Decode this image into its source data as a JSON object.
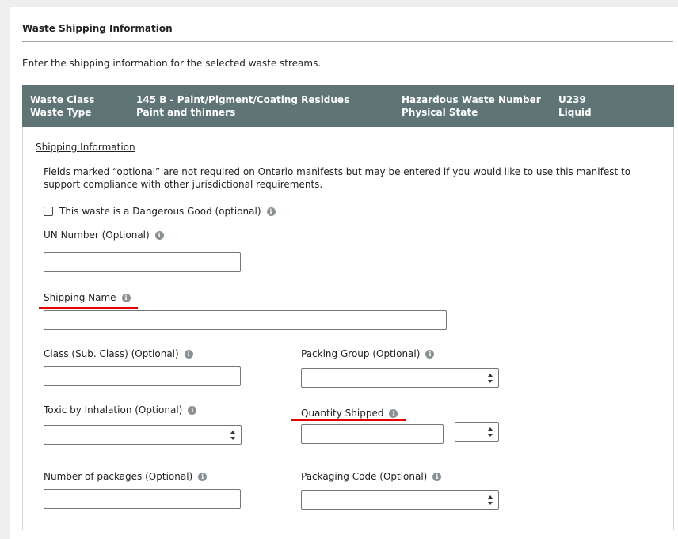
{
  "section": {
    "title": "Waste Shipping Information",
    "intro": "Enter the shipping information for the selected waste streams."
  },
  "waste_bar": {
    "waste_class_label": "Waste Class",
    "waste_class_value": "145 B - Paint/Pigment/Coating Residues",
    "waste_type_label": "Waste Type",
    "waste_type_value": "Paint and thinners",
    "hazardous_number_label": "Hazardous Waste Number",
    "hazardous_number_value": "U239",
    "physical_state_label": "Physical State",
    "physical_state_value": "Liquid",
    "background_color": "#5f7474"
  },
  "shipping": {
    "heading": "Shipping Information",
    "note": "Fields marked “optional” are not required on Ontario manifests but may be entered if you would like to use this manifest to support compliance with other jurisdictional requirements.",
    "dangerous_good_label": "This waste is a Dangerous Good (optional)",
    "dangerous_good_checked": false,
    "un_number_label": "UN Number (Optional)",
    "un_number_value": "",
    "shipping_name_label": "Shipping Name",
    "shipping_name_value": "",
    "class_label": "Class (Sub. Class) (Optional)",
    "class_value": "",
    "packing_group_label": "Packing Group (Optional)",
    "packing_group_value": "",
    "toxic_label": "Toxic by Inhalation (Optional)",
    "toxic_value": "",
    "quantity_label": "Quantity Shipped",
    "quantity_value": "",
    "quantity_unit_value": "",
    "packages_label": "Number of packages (Optional)",
    "packages_value": "",
    "packaging_code_label": "Packaging Code (Optional)",
    "packaging_code_value": ""
  },
  "icons": {
    "info": "info-icon",
    "info_glyph": "i"
  },
  "highlight_color": "#e60000"
}
